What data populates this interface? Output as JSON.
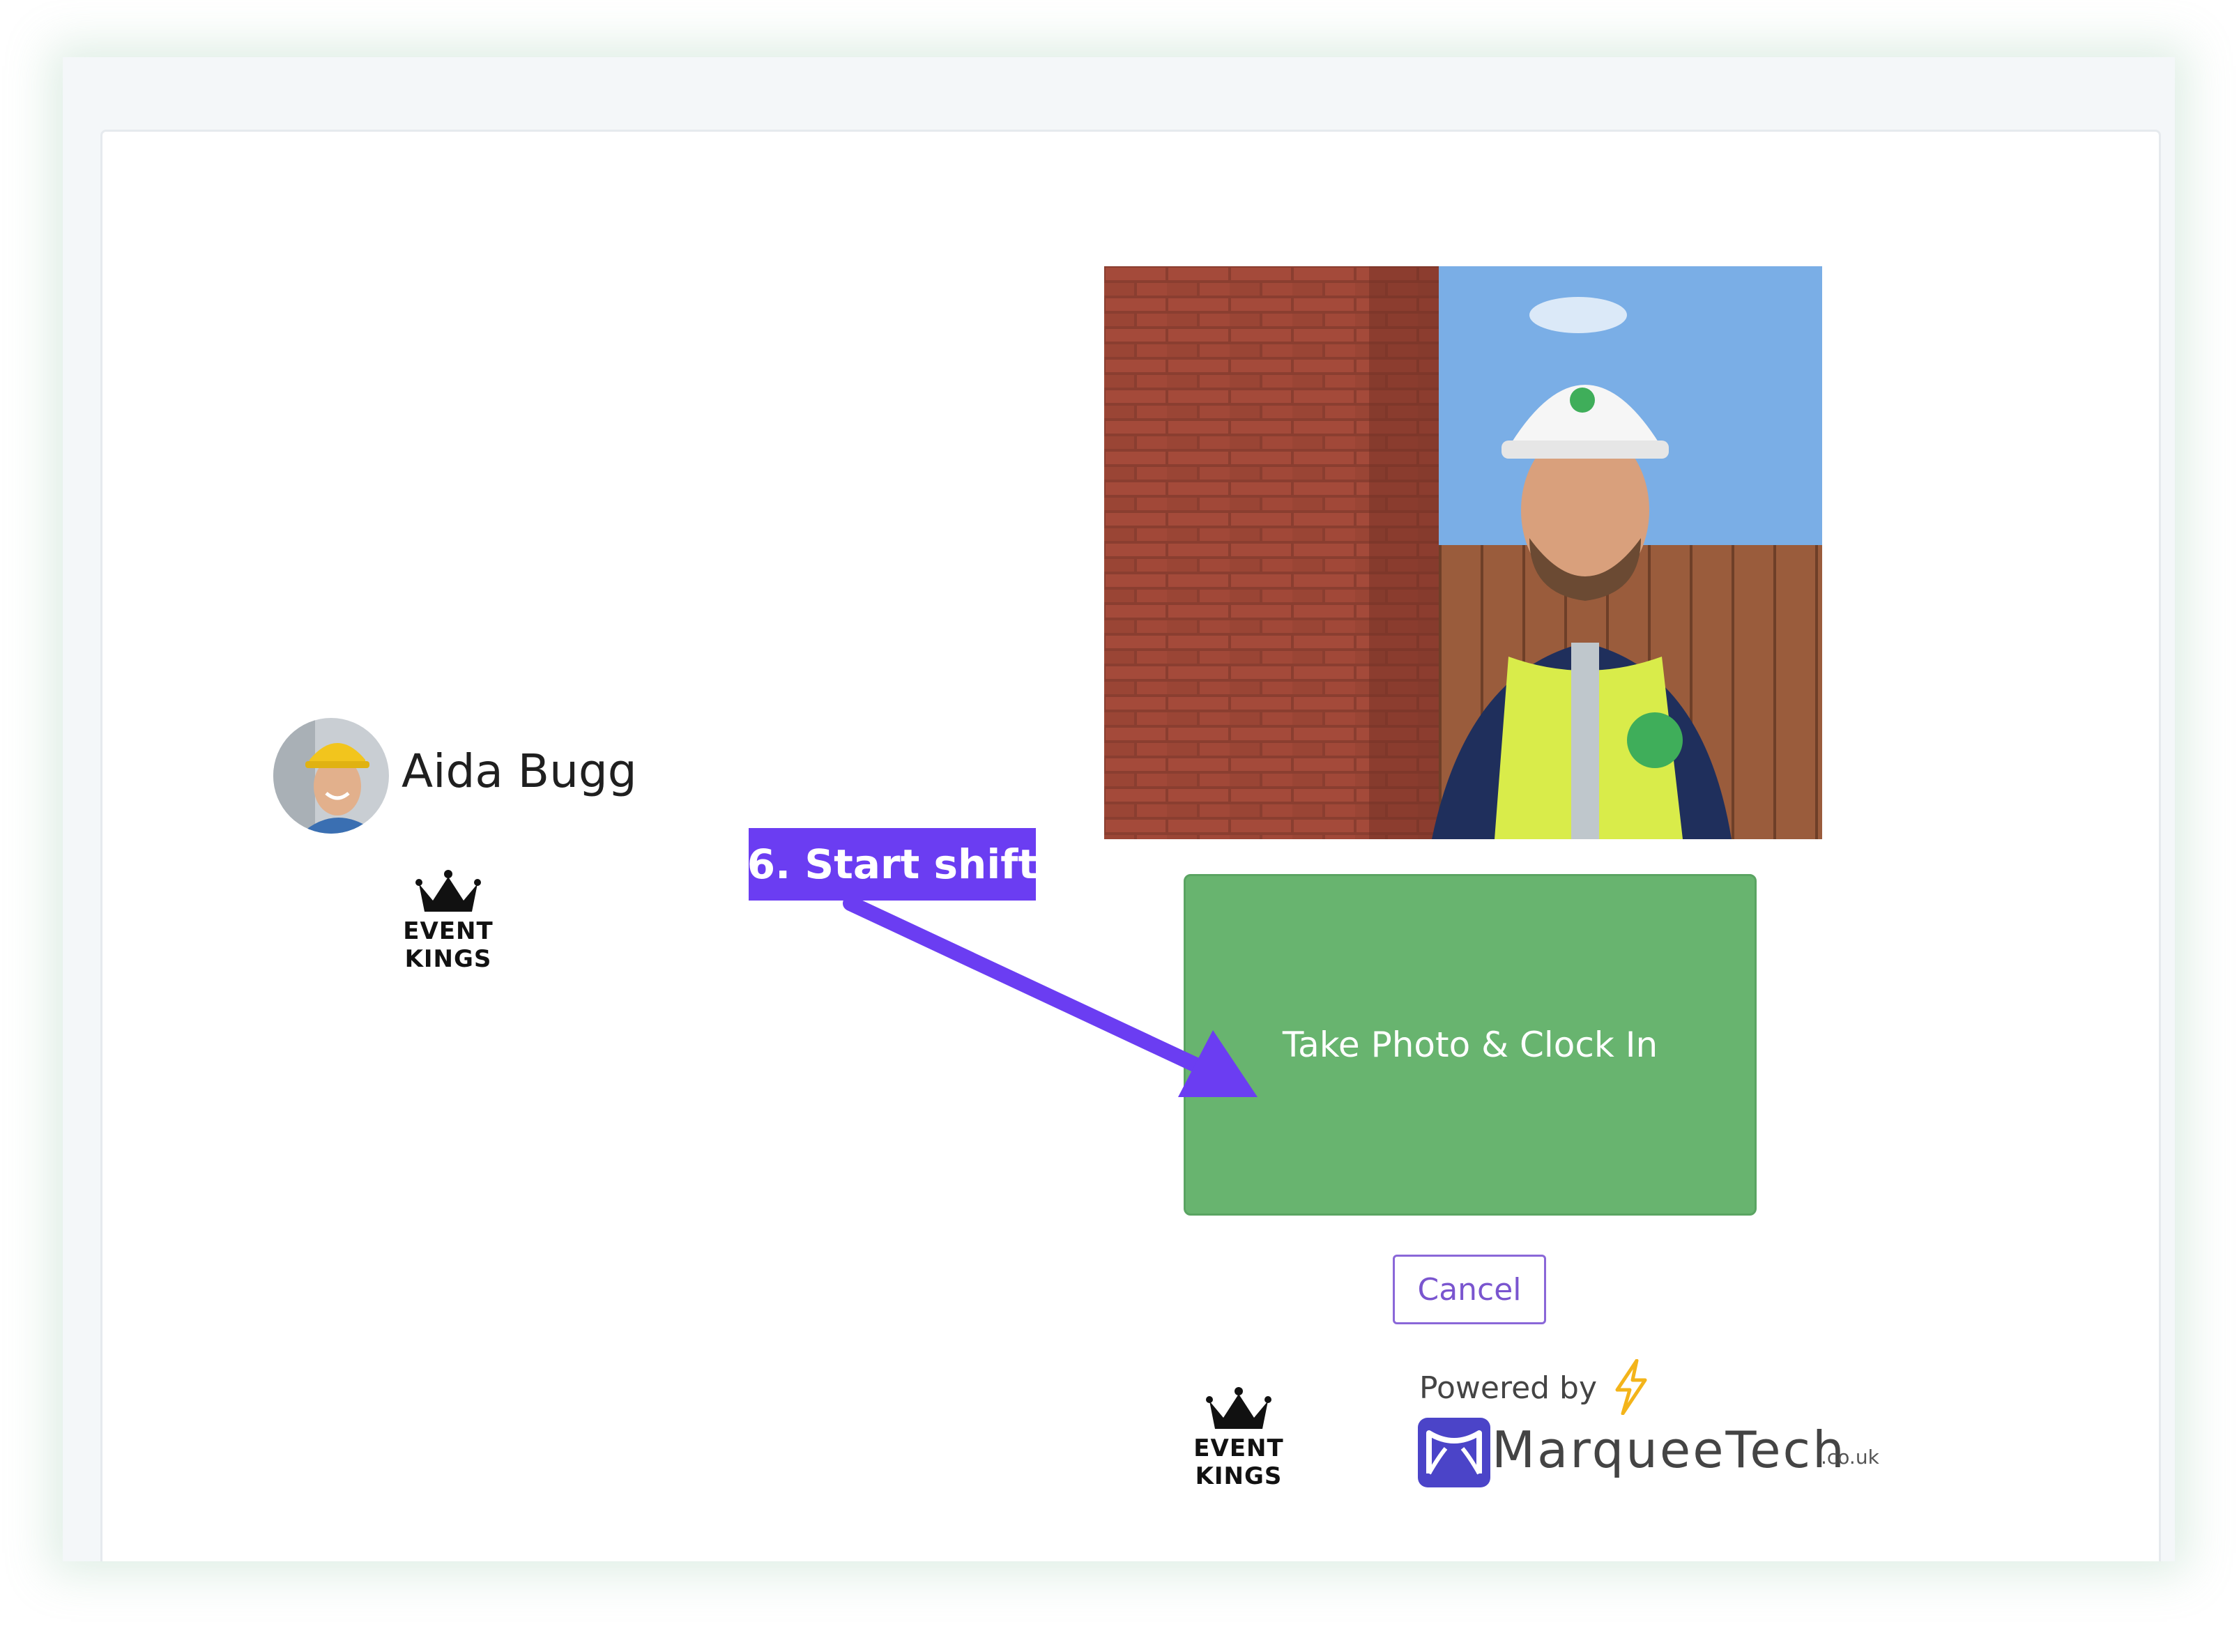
{
  "user": {
    "name": "Aida Bugg"
  },
  "branding": {
    "company_logo_line1": "EVENT",
    "company_logo_line2": "KINGS",
    "powered_by": "Powered by",
    "vendor_name": "MarqueeTech",
    "vendor_domain": ".co.uk"
  },
  "actions": {
    "clock_in_label": "Take Photo & Clock In",
    "cancel_label": "Cancel"
  },
  "annotation": {
    "label": "6. Start shift",
    "color": "#6b3df2"
  },
  "colors": {
    "clock_in": "#68b46f",
    "cancel": "#7a55cf"
  }
}
